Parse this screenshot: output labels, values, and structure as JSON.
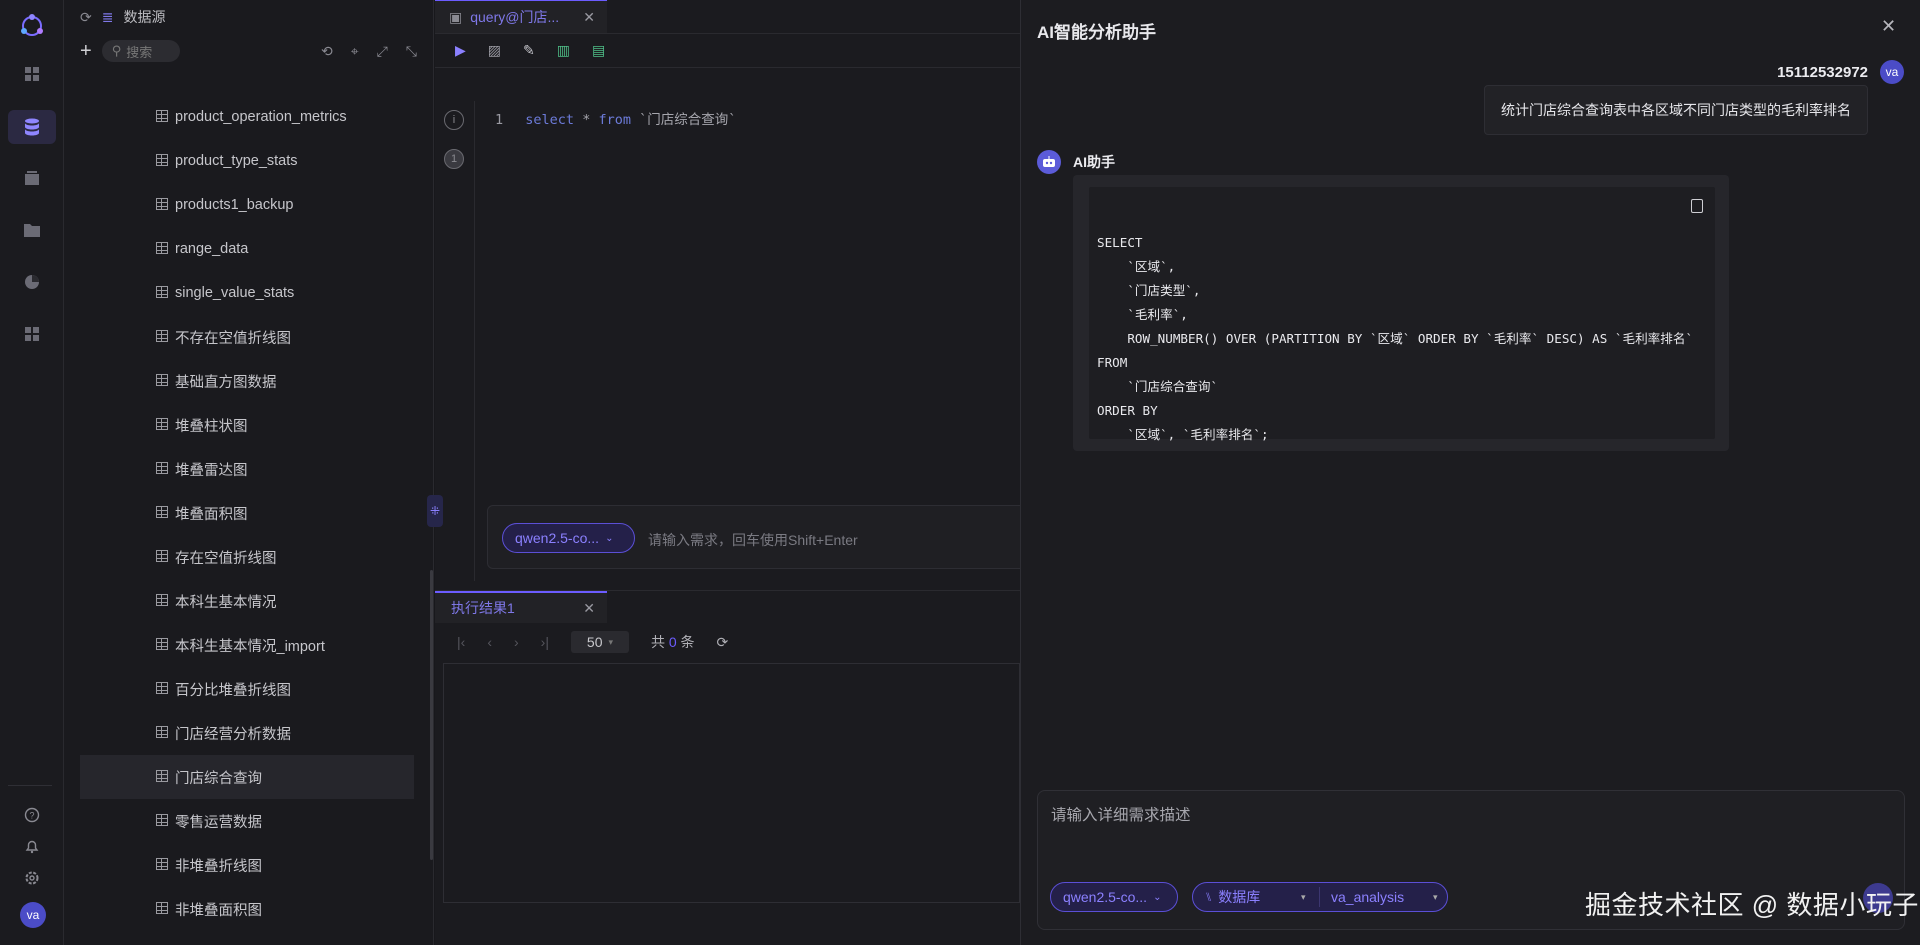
{
  "rail": {
    "icons": [
      "logo-icon",
      "grid-icon",
      "database-icon",
      "dashboard-icon",
      "folder-icon",
      "chart-icon",
      "apps-icon",
      "help-icon",
      "bell-icon",
      "settings-icon"
    ],
    "avatar": "va",
    "accent": "#8f86ff"
  },
  "tree": {
    "header": {
      "title": "数据源"
    },
    "search": {
      "placeholder": "搜索"
    },
    "items": [
      "product_operation_metrics",
      "product_type_stats",
      "products1_backup",
      "range_data",
      "single_value_stats",
      "不存在空值折线图",
      "基础直方图数据",
      "堆叠柱状图",
      "堆叠雷达图",
      "堆叠面积图",
      "存在空值折线图",
      "本科生基本情况",
      "本科生基本情况_import",
      "百分比堆叠折线图",
      "门店经营分析数据",
      "门店综合查询",
      "零售运营数据",
      "非堆叠折线图",
      "非堆叠面积图"
    ],
    "selected": "门店综合查询"
  },
  "editor": {
    "tab": {
      "label": "query@门店..."
    },
    "line_no": "1",
    "code": {
      "select": "select",
      "star": "*",
      "from": "from",
      "table": "`门店综合查询`"
    },
    "gutter": [
      "i",
      "1"
    ],
    "ai_input": {
      "model": "qwen2.5-co...",
      "placeholder": "请输入需求，回车使用Shift+Enter"
    },
    "results": {
      "tab": "执行结果1",
      "page_size": "50",
      "total_prefix": "共",
      "total_count": "0",
      "total_suffix": "条"
    }
  },
  "drawer": {
    "title": "AI智能分析助手",
    "close": "✕",
    "user": {
      "name": "15112532972",
      "avatar": "va",
      "message": "统计门店综合查询表中各区域不同门店类型的毛利率排名"
    },
    "bot": {
      "name": "AI助手"
    },
    "sql": "SELECT\n    `区域`,\n    `门店类型`,\n    `毛利率`,\n    ROW_NUMBER() OVER (PARTITION BY `区域` ORDER BY `毛利率` DESC) AS `毛利率排名`\nFROM\n    `门店综合查询`\nORDER BY\n    `区域`, `毛利率排名`;",
    "prompt": {
      "placeholder": "请输入详细需求描述",
      "model": "qwen2.5-co...",
      "db_type": "数据库",
      "db_name": "va_analysis"
    }
  },
  "watermark": "掘金技术社区 @ 数据小玩子"
}
